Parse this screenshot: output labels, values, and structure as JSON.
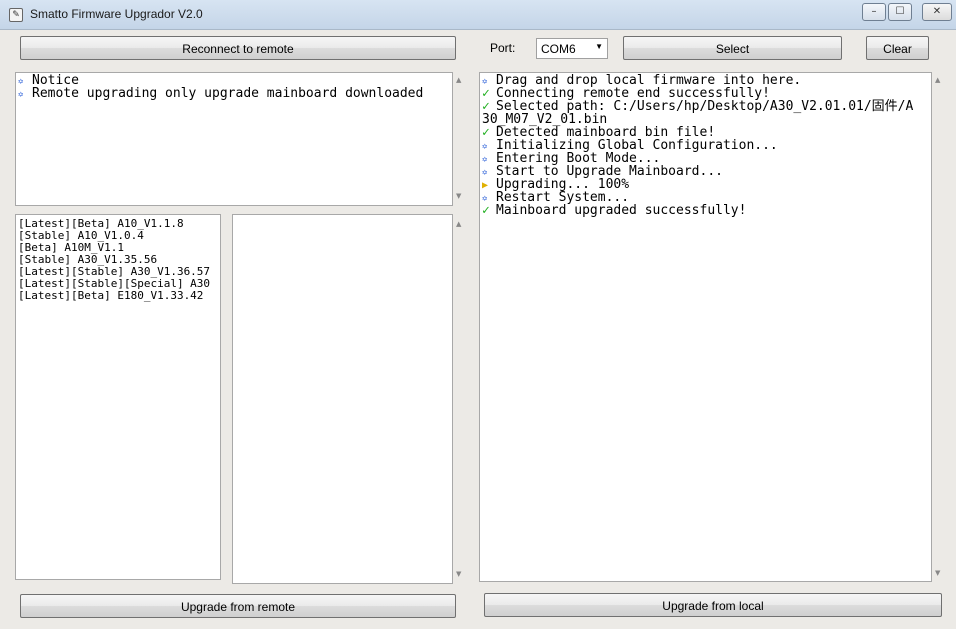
{
  "window": {
    "title": "Smatto Firmware Upgrador V2.0",
    "minimize": "–",
    "maximize": "☐",
    "close": "✕"
  },
  "toolbar": {
    "reconnect_label": "Reconnect to remote",
    "port_label": "Port:",
    "port_value": "COM6",
    "select_label": "Select",
    "clear_label": "Clear"
  },
  "notice_log": [
    {
      "icon": "info-icon",
      "text": "Notice"
    },
    {
      "icon": "info-icon",
      "text": "Remote upgrading only upgrade mainboard downloaded"
    }
  ],
  "firmware_list": [
    "[Latest][Beta] A10_V1.1.8",
    "[Stable] A10_V1.0.4",
    "[Beta] A10M_V1.1",
    "[Stable] A30_V1.35.56",
    "[Latest][Stable] A30_V1.36.57",
    "[Latest][Stable][Special] A30",
    "[Latest][Beta] E180_V1.33.42"
  ],
  "main_log": [
    {
      "icon": "info-icon",
      "text": "Drag and drop local firmware into here."
    },
    {
      "icon": "check-icon",
      "text": "Connecting remote end successfully!"
    },
    {
      "icon": "check-icon",
      "text": "Selected path: C:/Users/hp/Desktop/A30_V2.01.01/固件/A"
    },
    {
      "icon": "none",
      "text": "30_M07_V2_01.bin"
    },
    {
      "icon": "check-icon",
      "text": "Detected mainboard bin file!"
    },
    {
      "icon": "info-icon",
      "text": "Initializing Global Configuration..."
    },
    {
      "icon": "info-icon",
      "text": "Entering Boot Mode..."
    },
    {
      "icon": "info-icon",
      "text": "Start to Upgrade Mainboard..."
    },
    {
      "icon": "progress-icon",
      "text": "Upgrading... 100%"
    },
    {
      "icon": "info-icon",
      "text": "Restart System..."
    },
    {
      "icon": "check-icon",
      "text": "Mainboard upgraded successfully!"
    }
  ],
  "bottom": {
    "upgrade_remote_label": "Upgrade from remote",
    "upgrade_local_label": "Upgrade from local"
  },
  "colors": {
    "info": "#2a5fd8",
    "success": "#22b022",
    "progress": "#e0b000"
  }
}
